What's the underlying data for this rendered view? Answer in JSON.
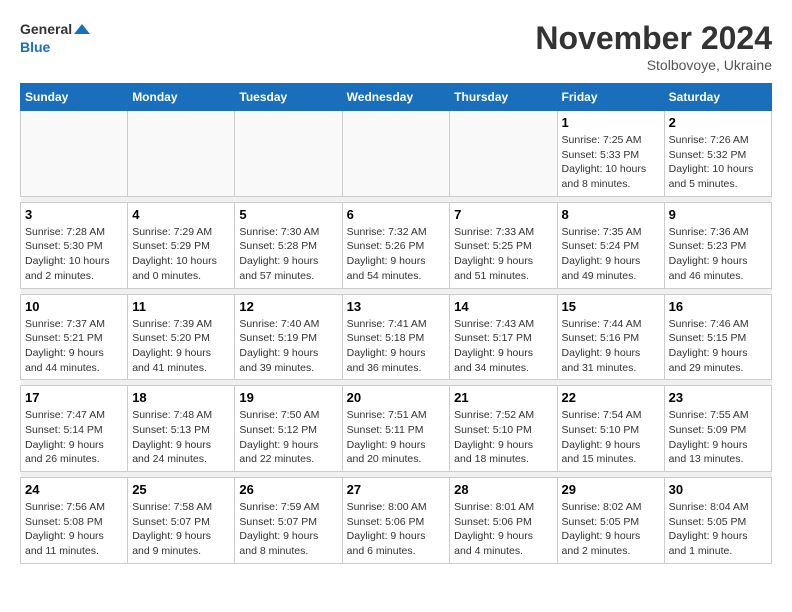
{
  "header": {
    "logo_general": "General",
    "logo_blue": "Blue",
    "month_year": "November 2024",
    "location": "Stolbovoye, Ukraine"
  },
  "weekdays": [
    "Sunday",
    "Monday",
    "Tuesday",
    "Wednesday",
    "Thursday",
    "Friday",
    "Saturday"
  ],
  "weeks": [
    [
      {
        "day": "",
        "info": ""
      },
      {
        "day": "",
        "info": ""
      },
      {
        "day": "",
        "info": ""
      },
      {
        "day": "",
        "info": ""
      },
      {
        "day": "",
        "info": ""
      },
      {
        "day": "1",
        "info": "Sunrise: 7:25 AM\nSunset: 5:33 PM\nDaylight: 10 hours\nand 8 minutes."
      },
      {
        "day": "2",
        "info": "Sunrise: 7:26 AM\nSunset: 5:32 PM\nDaylight: 10 hours\nand 5 minutes."
      }
    ],
    [
      {
        "day": "3",
        "info": "Sunrise: 7:28 AM\nSunset: 5:30 PM\nDaylight: 10 hours\nand 2 minutes."
      },
      {
        "day": "4",
        "info": "Sunrise: 7:29 AM\nSunset: 5:29 PM\nDaylight: 10 hours\nand 0 minutes."
      },
      {
        "day": "5",
        "info": "Sunrise: 7:30 AM\nSunset: 5:28 PM\nDaylight: 9 hours\nand 57 minutes."
      },
      {
        "day": "6",
        "info": "Sunrise: 7:32 AM\nSunset: 5:26 PM\nDaylight: 9 hours\nand 54 minutes."
      },
      {
        "day": "7",
        "info": "Sunrise: 7:33 AM\nSunset: 5:25 PM\nDaylight: 9 hours\nand 51 minutes."
      },
      {
        "day": "8",
        "info": "Sunrise: 7:35 AM\nSunset: 5:24 PM\nDaylight: 9 hours\nand 49 minutes."
      },
      {
        "day": "9",
        "info": "Sunrise: 7:36 AM\nSunset: 5:23 PM\nDaylight: 9 hours\nand 46 minutes."
      }
    ],
    [
      {
        "day": "10",
        "info": "Sunrise: 7:37 AM\nSunset: 5:21 PM\nDaylight: 9 hours\nand 44 minutes."
      },
      {
        "day": "11",
        "info": "Sunrise: 7:39 AM\nSunset: 5:20 PM\nDaylight: 9 hours\nand 41 minutes."
      },
      {
        "day": "12",
        "info": "Sunrise: 7:40 AM\nSunset: 5:19 PM\nDaylight: 9 hours\nand 39 minutes."
      },
      {
        "day": "13",
        "info": "Sunrise: 7:41 AM\nSunset: 5:18 PM\nDaylight: 9 hours\nand 36 minutes."
      },
      {
        "day": "14",
        "info": "Sunrise: 7:43 AM\nSunset: 5:17 PM\nDaylight: 9 hours\nand 34 minutes."
      },
      {
        "day": "15",
        "info": "Sunrise: 7:44 AM\nSunset: 5:16 PM\nDaylight: 9 hours\nand 31 minutes."
      },
      {
        "day": "16",
        "info": "Sunrise: 7:46 AM\nSunset: 5:15 PM\nDaylight: 9 hours\nand 29 minutes."
      }
    ],
    [
      {
        "day": "17",
        "info": "Sunrise: 7:47 AM\nSunset: 5:14 PM\nDaylight: 9 hours\nand 26 minutes."
      },
      {
        "day": "18",
        "info": "Sunrise: 7:48 AM\nSunset: 5:13 PM\nDaylight: 9 hours\nand 24 minutes."
      },
      {
        "day": "19",
        "info": "Sunrise: 7:50 AM\nSunset: 5:12 PM\nDaylight: 9 hours\nand 22 minutes."
      },
      {
        "day": "20",
        "info": "Sunrise: 7:51 AM\nSunset: 5:11 PM\nDaylight: 9 hours\nand 20 minutes."
      },
      {
        "day": "21",
        "info": "Sunrise: 7:52 AM\nSunset: 5:10 PM\nDaylight: 9 hours\nand 18 minutes."
      },
      {
        "day": "22",
        "info": "Sunrise: 7:54 AM\nSunset: 5:10 PM\nDaylight: 9 hours\nand 15 minutes."
      },
      {
        "day": "23",
        "info": "Sunrise: 7:55 AM\nSunset: 5:09 PM\nDaylight: 9 hours\nand 13 minutes."
      }
    ],
    [
      {
        "day": "24",
        "info": "Sunrise: 7:56 AM\nSunset: 5:08 PM\nDaylight: 9 hours\nand 11 minutes."
      },
      {
        "day": "25",
        "info": "Sunrise: 7:58 AM\nSunset: 5:07 PM\nDaylight: 9 hours\nand 9 minutes."
      },
      {
        "day": "26",
        "info": "Sunrise: 7:59 AM\nSunset: 5:07 PM\nDaylight: 9 hours\nand 8 minutes."
      },
      {
        "day": "27",
        "info": "Sunrise: 8:00 AM\nSunset: 5:06 PM\nDaylight: 9 hours\nand 6 minutes."
      },
      {
        "day": "28",
        "info": "Sunrise: 8:01 AM\nSunset: 5:06 PM\nDaylight: 9 hours\nand 4 minutes."
      },
      {
        "day": "29",
        "info": "Sunrise: 8:02 AM\nSunset: 5:05 PM\nDaylight: 9 hours\nand 2 minutes."
      },
      {
        "day": "30",
        "info": "Sunrise: 8:04 AM\nSunset: 5:05 PM\nDaylight: 9 hours\nand 1 minute."
      }
    ]
  ]
}
